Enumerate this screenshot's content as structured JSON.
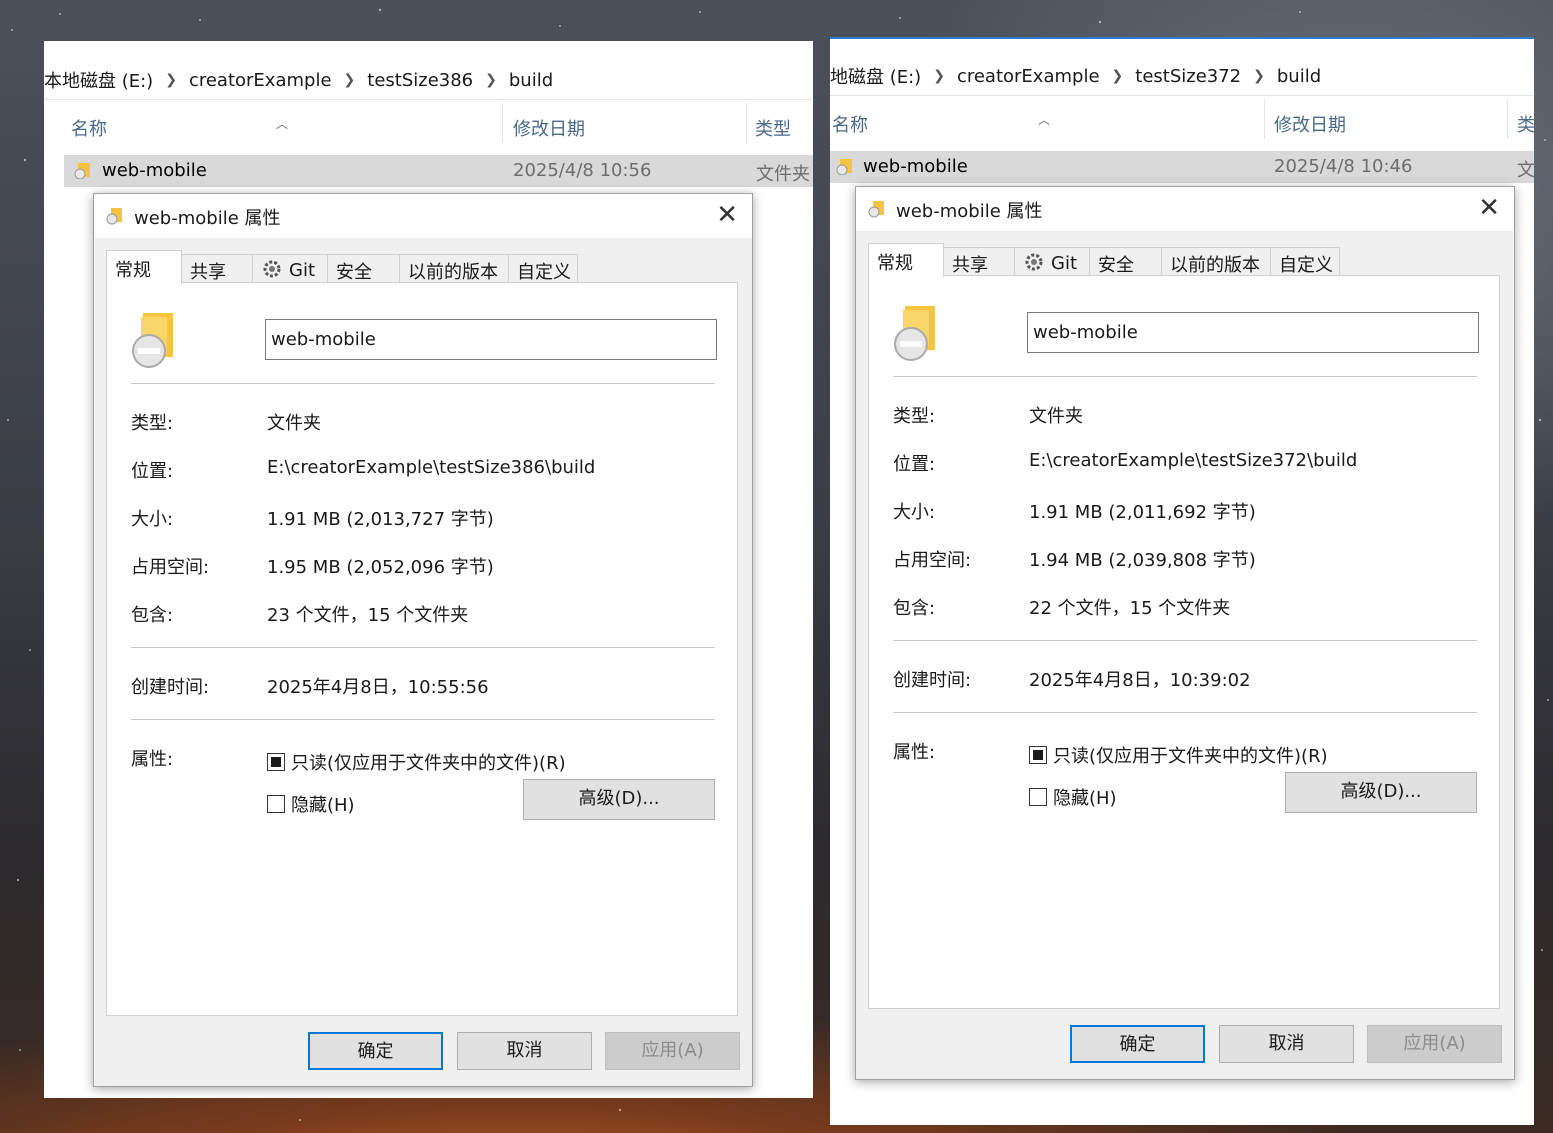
{
  "left": {
    "breadcrumb": [
      "本地磁盘 (E:)",
      "creatorExample",
      "testSize386",
      "build"
    ],
    "columns": {
      "name": "名称",
      "modified": "修改日期",
      "type": "类型"
    },
    "row": {
      "name": "web-mobile",
      "modified": "2025/4/8 10:56",
      "type": "文件夹"
    },
    "dialog": {
      "title": "web-mobile 属性",
      "tabs": [
        "常规",
        "共享",
        "Git",
        "安全",
        "以前的版本",
        "自定义"
      ],
      "folder_name": "web-mobile",
      "labels": {
        "type": "类型:",
        "location": "位置:",
        "size": "大小:",
        "size_on_disk": "占用空间:",
        "contains": "包含:",
        "created": "创建时间:",
        "attributes": "属性:"
      },
      "values": {
        "type": "文件夹",
        "location": "E:\\creatorExample\\testSize386\\build",
        "size": "1.91 MB (2,013,727 字节)",
        "size_on_disk": "1.95 MB (2,052,096 字节)",
        "contains": "23 个文件，15 个文件夹",
        "created": "2025年4月8日，10:55:56"
      },
      "readonly": "只读(仅应用于文件夹中的文件)(R)",
      "hidden": "隐藏(H)",
      "advanced": "高级(D)...",
      "ok": "确定",
      "cancel": "取消",
      "apply": "应用(A)"
    }
  },
  "right": {
    "breadcrumb": [
      "地磁盘 (E:)",
      "creatorExample",
      "testSize372",
      "build"
    ],
    "columns": {
      "name": "名称",
      "modified": "修改日期",
      "type": "类"
    },
    "row": {
      "name": "web-mobile",
      "modified": "2025/4/8 10:46",
      "type": "文"
    },
    "dialog": {
      "title": "web-mobile 属性",
      "tabs": [
        "常规",
        "共享",
        "Git",
        "安全",
        "以前的版本",
        "自定义"
      ],
      "folder_name": "web-mobile",
      "labels": {
        "type": "类型:",
        "location": "位置:",
        "size": "大小:",
        "size_on_disk": "占用空间:",
        "contains": "包含:",
        "created": "创建时间:",
        "attributes": "属性:"
      },
      "values": {
        "type": "文件夹",
        "location": "E:\\creatorExample\\testSize372\\build",
        "size": "1.91 MB (2,011,692 字节)",
        "size_on_disk": "1.94 MB (2,039,808 字节)",
        "contains": "22 个文件，15 个文件夹",
        "created": "2025年4月8日，10:39:02"
      },
      "readonly": "只读(仅应用于文件夹中的文件)(R)",
      "hidden": "隐藏(H)",
      "advanced": "高级(D)...",
      "ok": "确定",
      "cancel": "取消",
      "apply": "应用(A)"
    }
  },
  "colors": {
    "accent": "#0078d7",
    "folder": "#f5c542",
    "label_blue": "#4a6a8a"
  }
}
